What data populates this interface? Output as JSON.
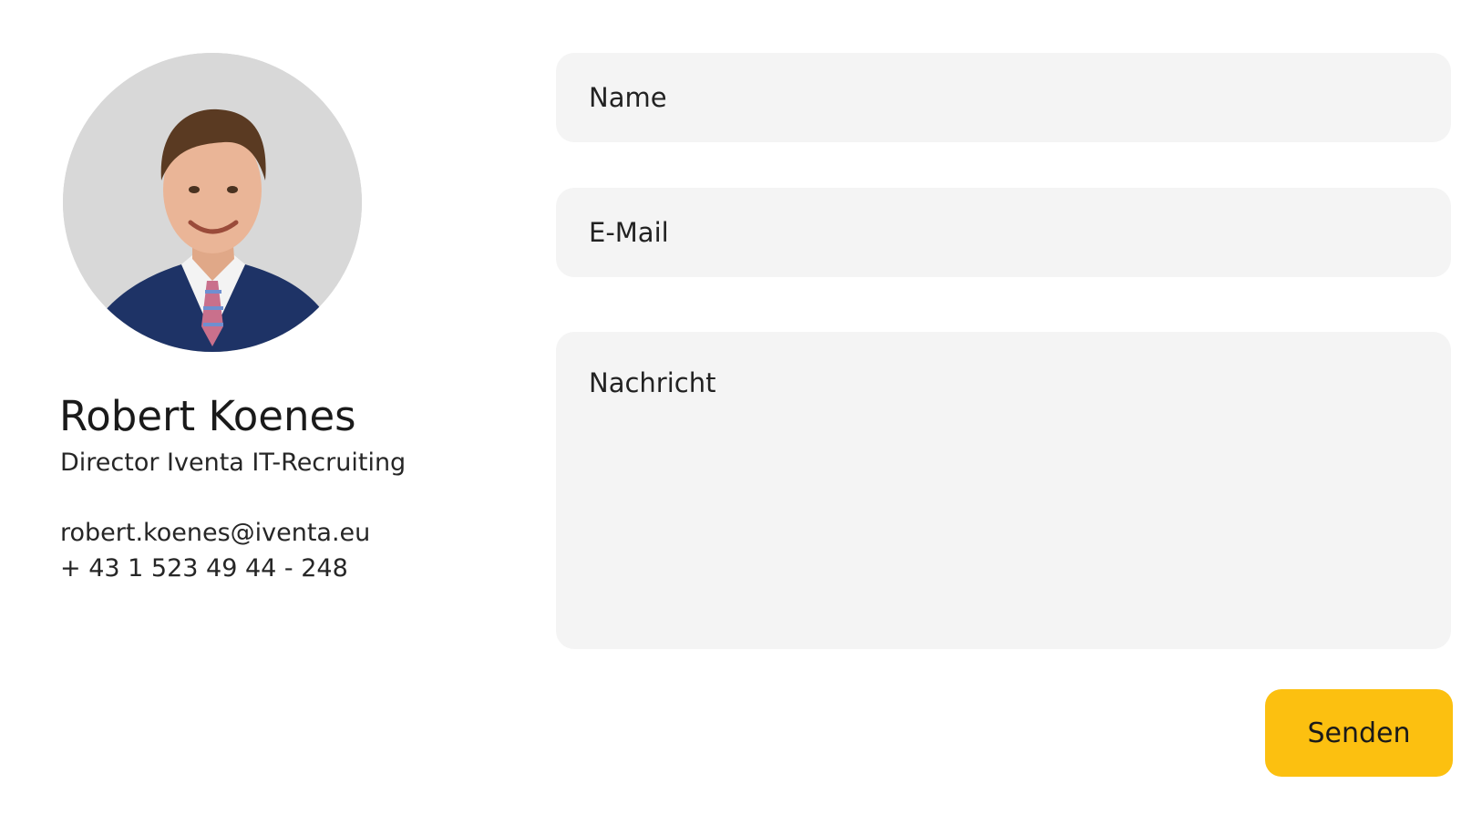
{
  "contact": {
    "name": "Robert Koenes",
    "role": "Director Iventa IT-Recruiting",
    "email": "robert.koenes@iventa.eu",
    "phone": "+ 43 1 523 49 44 - 248"
  },
  "form": {
    "name_placeholder": "Name",
    "email_placeholder": "E-Mail",
    "message_placeholder": "Nachricht",
    "submit_label": "Senden"
  },
  "colors": {
    "accent": "#fcc010",
    "field_background": "#f4f4f4",
    "text": "#1f1f1f"
  }
}
